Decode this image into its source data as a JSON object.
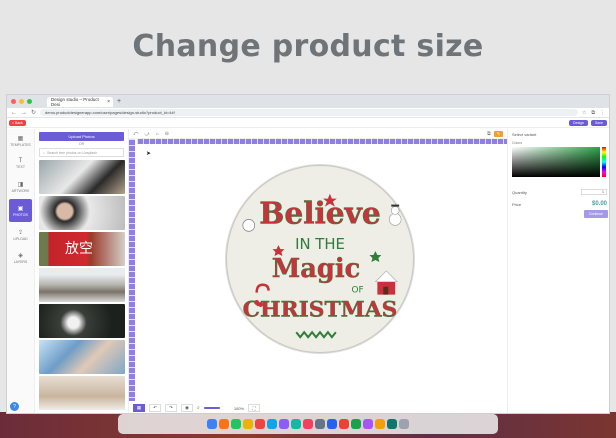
{
  "banner": {
    "title": "Change product size"
  },
  "browser": {
    "tab_title": "Design studio – Product Desi",
    "tab_close": "×",
    "new_tab": "+",
    "url": "demo.productdesignerapp.com/user/pages/design-studio?product_id=4#!",
    "colors": [
      "#ff5f57",
      "#febc2e",
      "#28c840"
    ]
  },
  "app": {
    "back_label": "< Back",
    "top_buttons": [
      "Design",
      "Save"
    ],
    "nav_rail": [
      {
        "icon": "templates-icon",
        "glyph": "▦",
        "label": "Templates"
      },
      {
        "icon": "text-icon",
        "glyph": "T",
        "label": "Text"
      },
      {
        "icon": "artwork-icon",
        "glyph": "◨",
        "label": "Artwork"
      },
      {
        "icon": "photos-icon",
        "glyph": "▣",
        "label": "Photos",
        "active": true
      },
      {
        "icon": "upload-icon",
        "glyph": "⇪",
        "label": "Upload"
      },
      {
        "icon": "layers-icon",
        "glyph": "◈",
        "label": "Layers"
      }
    ],
    "photos_panel": {
      "upload_label": "Upload Photos",
      "or_label": "OR",
      "search_placeholder": "Search free photos on Unsplash",
      "photo3_text": "放空"
    },
    "canvas": {
      "toolbar_left": [
        "⤺",
        "⤻",
        "⌂",
        "⊖"
      ],
      "toolbar_right_btn": "✎",
      "bottom_zoom": "100%",
      "design_text": {
        "line1": "Believe",
        "line2": "IN THE",
        "line3": "Magic",
        "line4": "OF",
        "line5": "CHRISTMAS"
      }
    },
    "right_panel": {
      "title": "Select variant",
      "colors_label": "Colors",
      "quantity_label": "Quantity",
      "quantity_value": "1",
      "price_label": "Price",
      "price_value": "$0.00",
      "continue_label": "Continue"
    }
  }
}
